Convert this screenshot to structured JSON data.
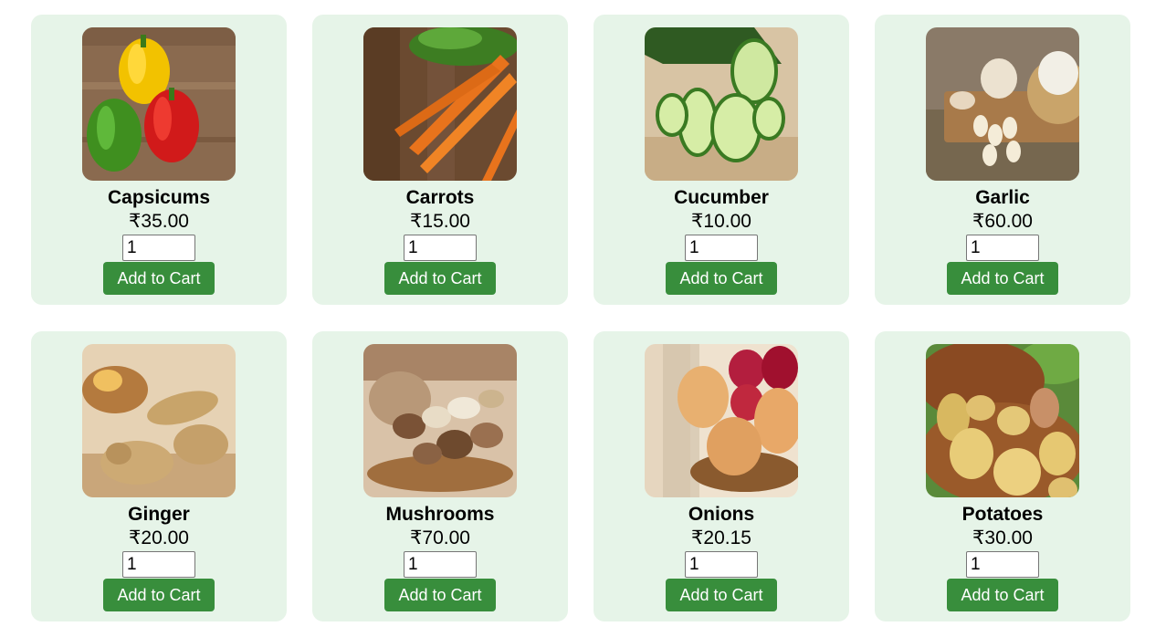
{
  "products": [
    {
      "name": "Capsicums",
      "price": "₹35.00",
      "qty": "1",
      "button": "Add to Cart",
      "image": "capsicums-image"
    },
    {
      "name": "Carrots",
      "price": "₹15.00",
      "qty": "1",
      "button": "Add to Cart",
      "image": "carrots-image"
    },
    {
      "name": "Cucumber",
      "price": "₹10.00",
      "qty": "1",
      "button": "Add to Cart",
      "image": "cucumber-image"
    },
    {
      "name": "Garlic",
      "price": "₹60.00",
      "qty": "1",
      "button": "Add to Cart",
      "image": "garlic-image"
    },
    {
      "name": "Ginger",
      "price": "₹20.00",
      "qty": "1",
      "button": "Add to Cart",
      "image": "ginger-image"
    },
    {
      "name": "Mushrooms",
      "price": "₹70.00",
      "qty": "1",
      "button": "Add to Cart",
      "image": "mushrooms-image"
    },
    {
      "name": "Onions",
      "price": "₹20.15",
      "qty": "1",
      "button": "Add to Cart",
      "image": "onions-image"
    },
    {
      "name": "Potatoes",
      "price": "₹30.00",
      "qty": "1",
      "button": "Add to Cart",
      "image": "potatoes-image"
    }
  ],
  "colors": {
    "card_background": "#e6f4e8",
    "button_background": "#388e3c",
    "button_text": "#ffffff"
  }
}
